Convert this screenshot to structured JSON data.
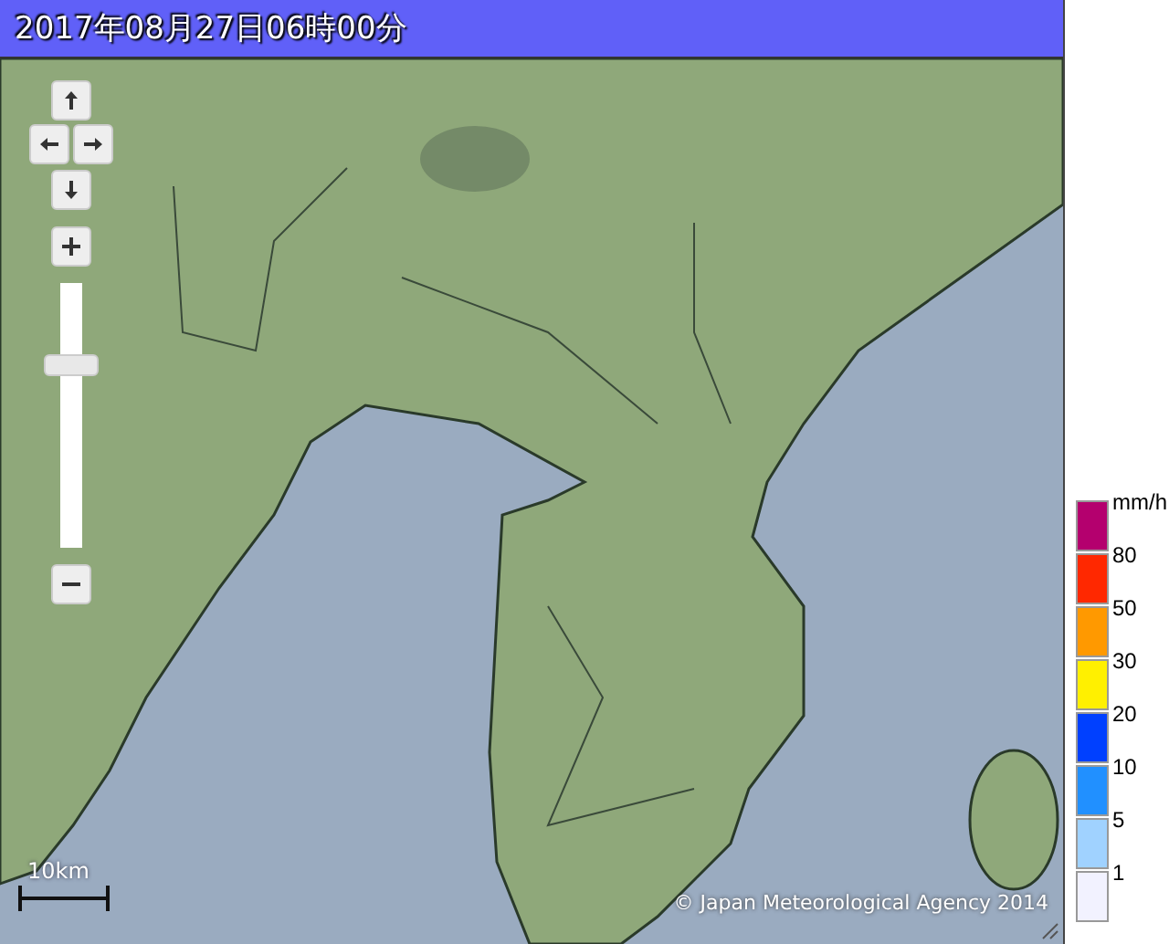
{
  "title_bar": {
    "title": "2017年08月27日06時00分"
  },
  "map": {
    "zoom_slider": {
      "level": 0.71
    },
    "scale": "10km",
    "attribution": "© Japan Meteorological Agency 2014"
  },
  "legend": [
    {
      "label": "mm/h",
      "color": "#b4006e"
    },
    {
      "label": "80",
      "color": "#ff2800"
    },
    {
      "label": "50",
      "color": "#ff9900"
    },
    {
      "label": "30",
      "color": "#fff000"
    },
    {
      "label": "20",
      "color": "#0040ff"
    },
    {
      "label": "10",
      "color": "#2190ff"
    },
    {
      "label": "5",
      "color": "#a0d2ff"
    },
    {
      "label": "1",
      "color": "#f2f2ff"
    }
  ]
}
